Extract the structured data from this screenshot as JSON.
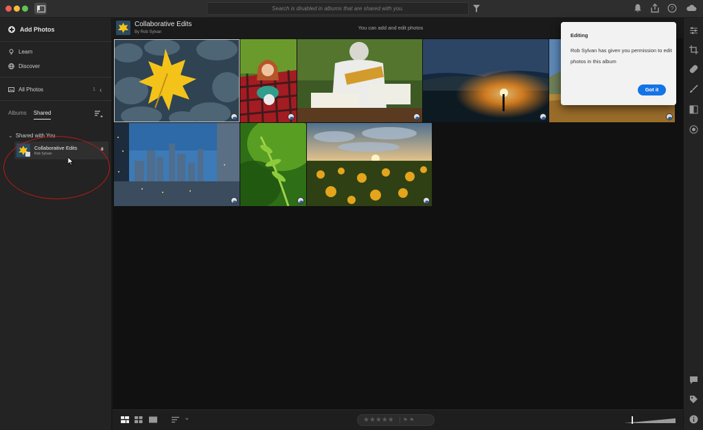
{
  "titlebar": {
    "search_placeholder": "Search is disabled in albums that are shared with you."
  },
  "sidebar": {
    "add_photos": "Add Photos",
    "learn": "Learn",
    "discover": "Discover",
    "all_photos": "All Photos",
    "all_photos_count": "1",
    "tabs": [
      "Albums",
      "Shared"
    ],
    "active_tab": "Shared",
    "section_header": "Shared with You",
    "album": {
      "title": "Collaborative Edits",
      "owner": "Rob Sylvan",
      "count": "8"
    }
  },
  "header": {
    "title": "Collaborative Edits",
    "byline": "By Rob Sylvan",
    "note": "You can add and edit photos"
  },
  "photos": [
    {
      "subject": "yellow maple leaf on frosty leaves",
      "selected": true
    },
    {
      "subject": "girl lying on red checkered blanket"
    },
    {
      "subject": "beekeeper holding frame"
    },
    {
      "subject": "steel wool light painting at night"
    },
    {
      "subject": "mountain meadow landscape"
    },
    {
      "subject": "city skyline at dusk"
    },
    {
      "subject": "green fern"
    },
    {
      "subject": "sunflower field at sunset"
    }
  ],
  "popover": {
    "title": "Editing",
    "body": "Rob Sylvan has given you permission to edit photos in this album",
    "button": "Got it"
  },
  "colors": {
    "accent": "#1473e6",
    "annotation": "#c01818"
  }
}
